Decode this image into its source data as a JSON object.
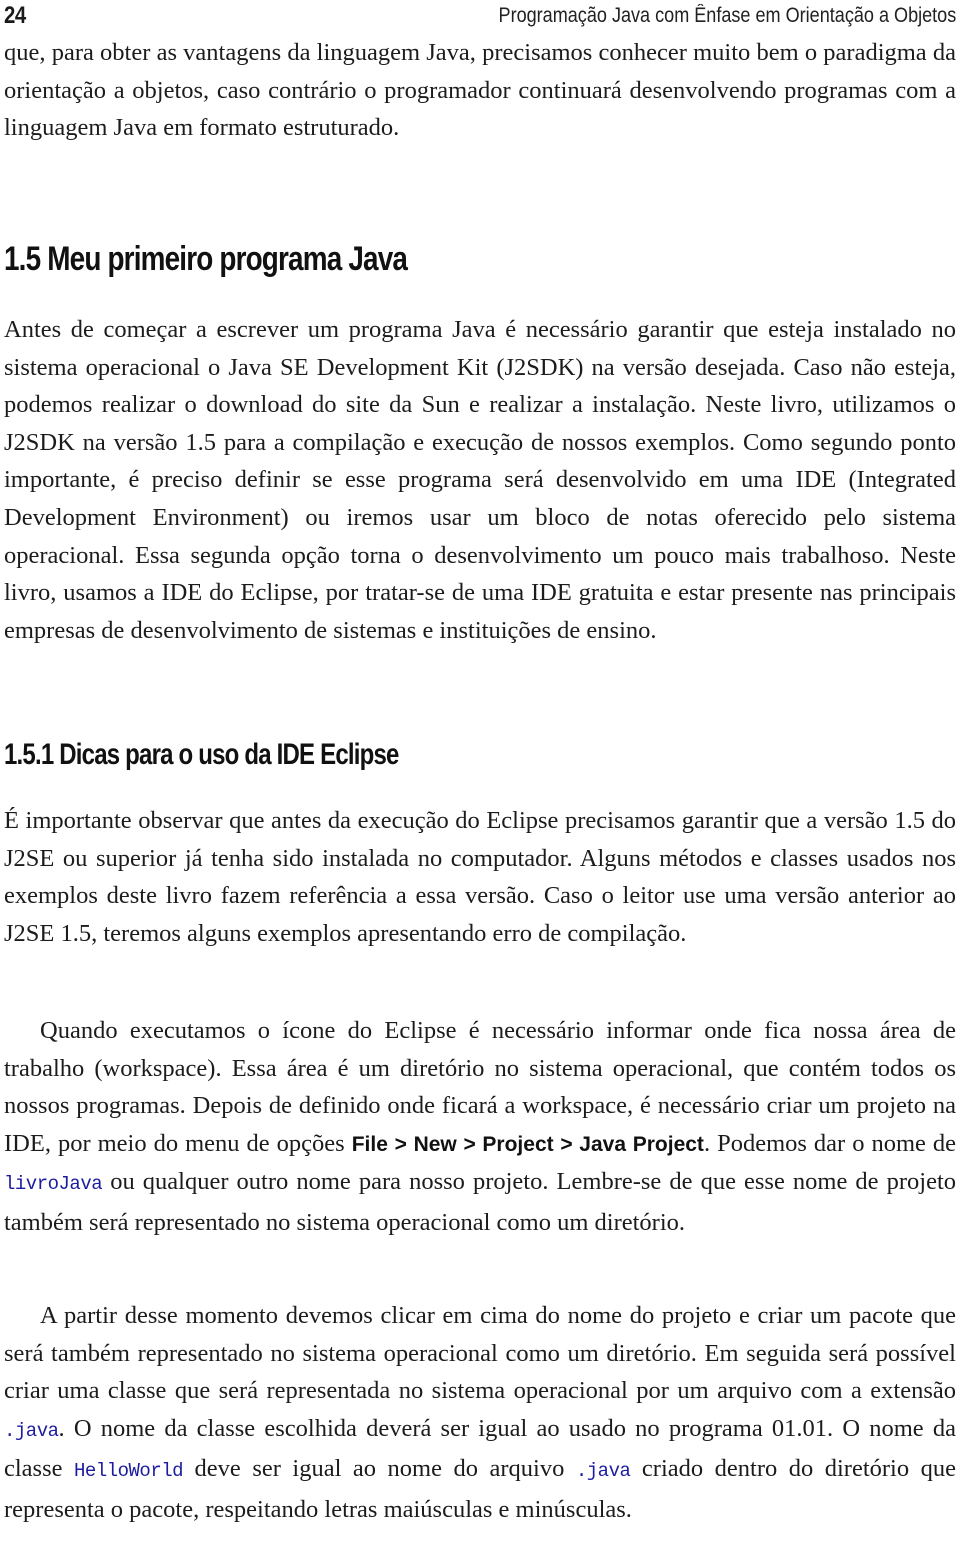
{
  "header": {
    "page_number": "24",
    "running_title": "Programação Java com Ênfase em Orientação a Objetos"
  },
  "intro_paragraph": "que, para obter as vantagens da linguagem Java, precisamos conhecer muito bem o paradigma da orientação a objetos, caso contrário o programador continuará desenvolvendo programas com a linguagem Java em formato estruturado.",
  "section_1_5": {
    "title": "1.5 Meu primeiro programa Java",
    "paragraph": "Antes de começar a escrever um programa Java é necessário garantir que esteja instalado no sistema operacional o Java SE Development Kit (J2SDK) na versão desejada. Caso não esteja, podemos realizar o download do site da Sun e realizar a instalação. Neste livro, utilizamos o J2SDK na versão 1.5 para a compilação e execução de nossos exemplos. Como segundo ponto importante, é preciso definir se esse programa será desenvolvido em uma IDE (Integrated Development Environment) ou iremos usar um bloco de notas oferecido pelo sistema operacional. Essa segunda opção torna o desenvolvimento um pouco mais trabalhoso. Neste livro, usamos a IDE do Eclipse, por tratar-se de uma IDE gratuita e estar presente nas principais empresas de desenvolvimento de sistemas e instituições de ensino."
  },
  "section_1_5_1": {
    "title": "1.5.1 Dicas para o uso da IDE Eclipse",
    "paragraph_1": "É importante observar que antes da execução do Eclipse precisamos garantir que a versão 1.5 do J2SE ou superior já tenha sido instalada no computador. Alguns métodos e classes usados nos exemplos deste livro fazem referência a essa versão. Caso o leitor use uma versão anterior ao J2SE 1.5, teremos alguns exemplos apresentando erro de compilação.",
    "paragraph_2": {
      "part_1": "Quando executamos o ícone do Eclipse é necessário informar onde fica nossa área de trabalho (workspace). Essa área é um diretório no sistema operacional, que contém todos os nossos programas. Depois de definido onde ficará a workspace, é necessário criar um projeto na IDE, por meio do menu de opções ",
      "menu_path": "File > New > Project > Java Project",
      "part_2": ". Podemos dar o nome de ",
      "project_name": "livroJava",
      "part_3": " ou qualquer outro nome para nosso projeto. Lembre-se de que esse nome de projeto também será representado no sistema operacional como um diretório."
    },
    "paragraph_3": {
      "part_1": "A partir desse momento devemos clicar em cima do nome do projeto e criar um pacote que será também representado no sistema operacional como um diretório. Em seguida será possível criar uma classe que será representada no sistema operacional por um arquivo com a extensão ",
      "extension_1": ".java",
      "part_2": ". O nome da classe escolhida deverá ser igual ao usado no programa 01.01. O nome da classe ",
      "class_name": "HelloWorld",
      "part_3": " deve ser igual ao nome do arquivo ",
      "extension_2": ".java",
      "part_4": " criado dentro do diretório que representa o pacote, respeitando letras maiúsculas e minúsculas."
    }
  },
  "colors": {
    "text": "#1c1c1c",
    "code": "#1c1ca0",
    "background": "#ffffff"
  }
}
